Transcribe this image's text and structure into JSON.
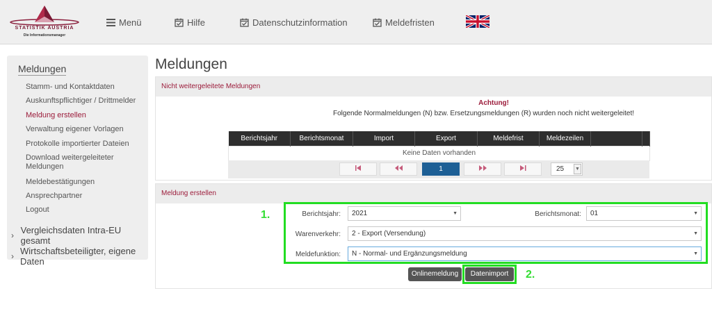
{
  "header": {
    "logo_line1": "STATISTIK AUSTRIA",
    "logo_line2": "Die Informationsmanager",
    "nav": [
      {
        "label": "Menü",
        "icon": "hamburger-icon"
      },
      {
        "label": "Hilfe",
        "icon": "calendar-check-icon"
      },
      {
        "label": "Datenschutzinformation",
        "icon": "calendar-check-icon"
      },
      {
        "label": "Meldefristen",
        "icon": "calendar-check-icon"
      }
    ],
    "language_flag": "uk-flag-icon"
  },
  "sidebar": {
    "title": "Meldungen",
    "items": [
      "Stamm- und Kontaktdaten",
      "Auskunftspflichtiger / Drittmelder",
      "Meldung erstellen",
      "Verwaltung eigener Vorlagen",
      "Protokolle importierter Dateien",
      "Download weitergeleiteter Meldungen",
      "Meldebestätigungen",
      "Ansprechpartner",
      "Logout"
    ],
    "active_item": "Meldung erstellen",
    "groups": [
      "Vergleichsdaten Intra-EU gesamt",
      "Wirtschaftsbeteiligter, eigene Daten"
    ]
  },
  "main": {
    "title": "Meldungen",
    "panel1": {
      "heading": "Nicht weitergeleitete Meldungen",
      "warning_title": "Achtung!",
      "warning_text": "Folgende Normalmeldungen (N) bzw. Ersetzungsmeldungen (R) wurden noch nicht weitergeleitet!",
      "columns": [
        "Berichtsjahr",
        "Berichtsmonat",
        "Import",
        "Export",
        "Meldefrist",
        "Meldezeilen",
        "",
        ""
      ],
      "empty_text": "Keine Daten vorhanden",
      "pager": {
        "current_page": "1",
        "page_size": "25"
      }
    },
    "panel2": {
      "heading": "Meldung erstellen",
      "berichtsjahr_label": "Berichtsjahr:",
      "berichtsjahr_value": "2021",
      "berichtsmonat_label": "Berichtsmonat:",
      "berichtsmonat_value": "01",
      "warenverkehr_label": "Warenverkehr:",
      "warenverkehr_value": "2 - Export (Versendung)",
      "meldefunktion_label": "Meldefunktion:",
      "meldefunktion_value": "N - Normal- und Ergänzungsmeldung",
      "onlinemeldung_label": "Onlinemeldung",
      "datenimport_label": "Datenimport",
      "step1": "1.",
      "step2": "2."
    }
  },
  "colors": {
    "accent": "#9b1b3a",
    "highlight_green": "#22dd22",
    "pager_active": "#1d5f95",
    "table_header": "#2e2e2e"
  }
}
